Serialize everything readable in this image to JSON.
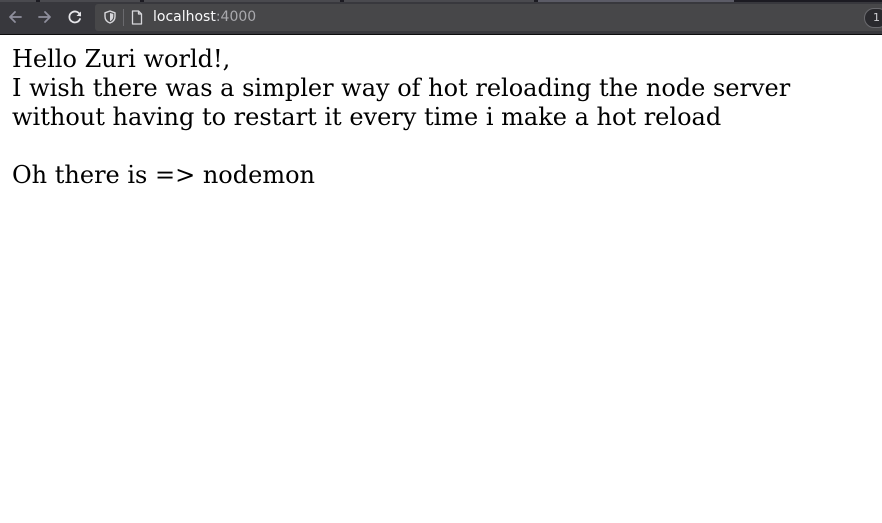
{
  "browser": {
    "url_host": "localhost",
    "url_port": ":4000",
    "badge_text": "1",
    "icons": {
      "back": "arrow-left-icon",
      "forward": "arrow-right-icon",
      "reload": "reload-icon",
      "tracking": "shield-icon",
      "page": "page-icon"
    },
    "colors": {
      "toolbar_bg": "#38383d",
      "urlbar_bg": "#474749",
      "url_host": "#f9f9fa",
      "url_port": "#a9a9ad"
    }
  },
  "page": {
    "lines": [
      "Hello Zuri world!,",
      "I wish there was a simpler way of hot reloading the node server",
      "without having to restart it every time i make a hot reload",
      "Oh there is => nodemon"
    ]
  }
}
